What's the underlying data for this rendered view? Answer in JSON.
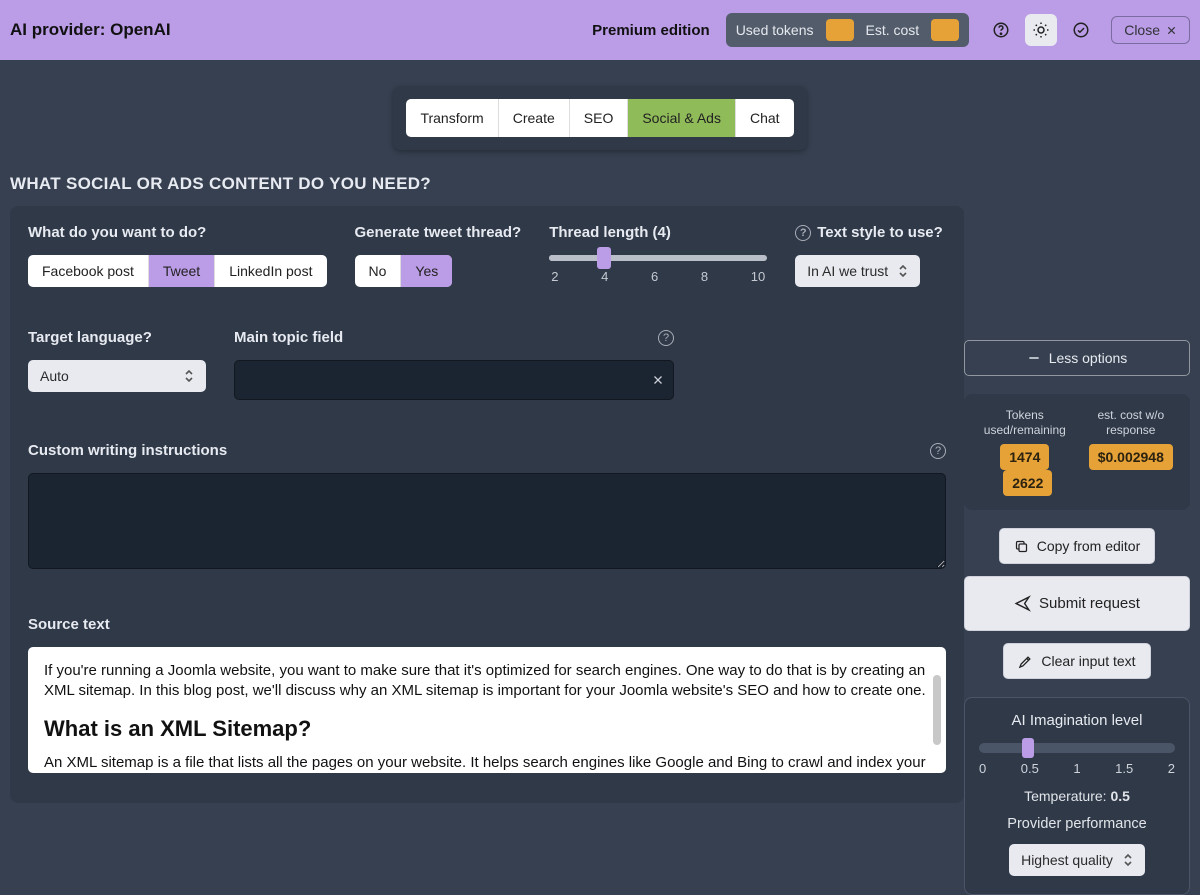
{
  "header": {
    "provider_prefix": "AI provider: ",
    "provider_name": "OpenAI",
    "premium": "Premium edition",
    "used_tokens_label": "Used tokens",
    "est_cost_label": "Est. cost",
    "close": "Close"
  },
  "tabs": {
    "items": [
      "Transform",
      "Create",
      "SEO",
      "Social & Ads",
      "Chat"
    ],
    "active": "Social & Ads"
  },
  "section_title": "WHAT SOCIAL OR ADS CONTENT DO YOU NEED?",
  "form": {
    "what_label": "What do you want to do?",
    "what_options": [
      "Facebook post",
      "Tweet",
      "LinkedIn post"
    ],
    "what_selected": "Tweet",
    "thread_label": "Generate tweet thread?",
    "thread_options": [
      "No",
      "Yes"
    ],
    "thread_selected": "Yes",
    "length_label": "Thread length (4)",
    "length_ticks": [
      "2",
      "4",
      "6",
      "8",
      "10"
    ],
    "length_value": 4,
    "style_label": "Text style to use?",
    "style_value": "In AI we trust",
    "lang_label": "Target language?",
    "lang_value": "Auto",
    "topic_label": "Main topic field",
    "topic_value": "",
    "custom_label": "Custom writing instructions",
    "custom_value": "",
    "source_label": "Source text",
    "source_paragraph1": "If you're running a Joomla website, you want to make sure that it's optimized for search engines. One way to do that is by creating an XML sitemap. In this blog post, we'll discuss why an XML sitemap is important for your Joomla website's SEO and how to create one.",
    "source_heading": "What is an XML Sitemap?",
    "source_paragraph2": "An XML sitemap is a file that lists all the pages on your website. It helps search engines like Google and Bing to crawl and index your website more efficiently. It provides information about the organization of your website's content, including the URLs of each page, the date"
  },
  "side": {
    "less_options": "Less options",
    "tokens_label": "Tokens used/remaining",
    "tokens_used": "1474",
    "tokens_remaining": "2622",
    "cost_label": "est. cost w/o response",
    "cost_value": "$0.002948",
    "copy": "Copy from editor",
    "submit": "Submit request",
    "clear": "Clear input text",
    "imag_title": "AI Imagination level",
    "imag_ticks": [
      "0",
      "0.5",
      "1",
      "1.5",
      "2"
    ],
    "temp_label": "Temperature: ",
    "temp_value": "0.5",
    "perf_label": "Provider performance",
    "perf_value": "Highest quality"
  }
}
